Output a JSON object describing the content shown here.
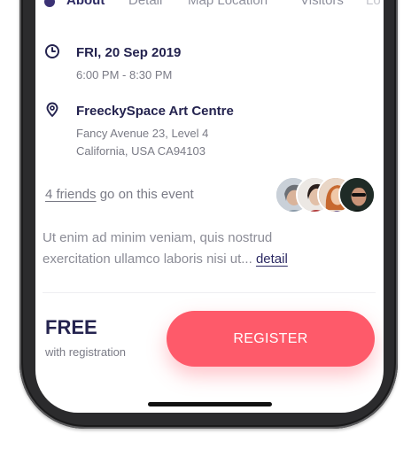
{
  "tabs": [
    {
      "label": "About",
      "active": true
    },
    {
      "label": "Detail",
      "active": false
    },
    {
      "label": "Map Location",
      "active": false
    },
    {
      "label": "Visitors",
      "active": false
    },
    {
      "label": "Lo",
      "active": false
    }
  ],
  "event": {
    "date": "FRI, 20 Sep 2019",
    "time": "6:00 PM - 8:30 PM",
    "venue": "FreeckySpace Art Centre",
    "address_line1": "Fancy Avenue 23, Level 4",
    "address_line2": "California, USA CA94103"
  },
  "friends": {
    "link_text": "4 friends",
    "suffix": "go on this event",
    "avatars": [
      "avatar-1",
      "avatar-2",
      "avatar-3",
      "avatar-4"
    ]
  },
  "description": {
    "text": "Ut enim ad minim veniam, quis nostrud exercitation ullamco laboris nisi ut...",
    "link": "detail"
  },
  "footer": {
    "price": "FREE",
    "price_note": "with registration",
    "register_label": "REGISTER"
  },
  "icons": {
    "time": "clock-icon",
    "location": "location-pin-icon"
  },
  "colors": {
    "accent": "#fe5a6a",
    "title": "#24234f",
    "muted": "#7a7b86",
    "tab_active": "#2c2a63"
  }
}
